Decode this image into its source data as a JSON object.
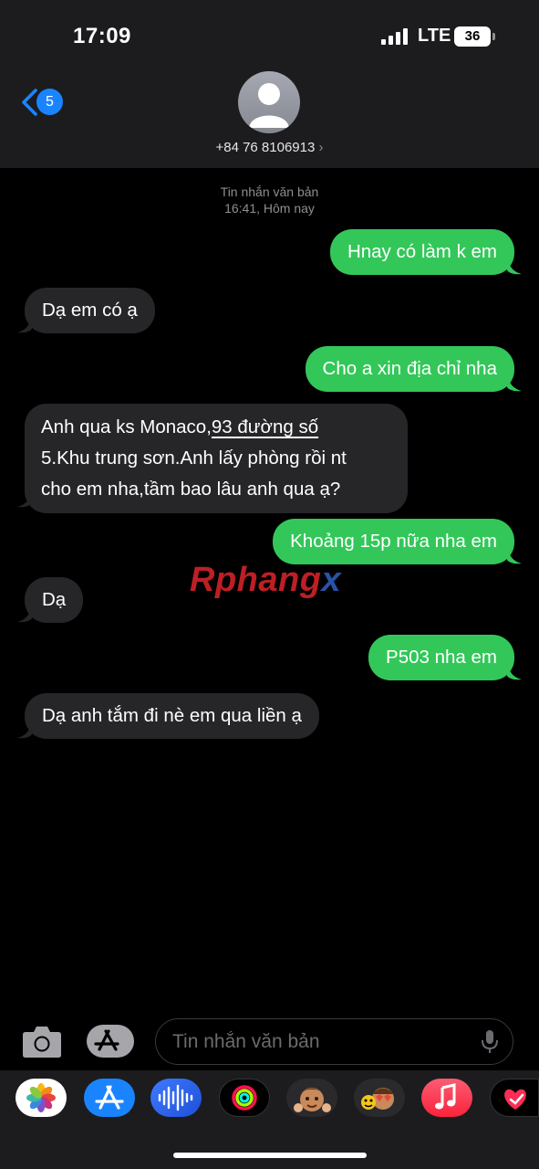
{
  "status_bar": {
    "time": "17:09",
    "network": "LTE",
    "battery": "36"
  },
  "header": {
    "back_badge": "5",
    "contact": "+84 76 8106913",
    "contact_chevron": "›"
  },
  "conversation": {
    "service_label": "Tin nhắn văn bản",
    "timestamp": "16:41, Hôm nay",
    "messages": [
      {
        "direction": "out",
        "text": "Hnay có làm k em"
      },
      {
        "direction": "in",
        "text": "Dạ em có ạ"
      },
      {
        "direction": "out",
        "text": "Cho a xin địa chỉ nha"
      },
      {
        "direction": "in",
        "parts": [
          "Anh qua ks Monaco,",
          "93 đường số",
          "5.Khu trung sơn.Anh lấy phòng rồi nt",
          "cho em nha,tầm bao lâu anh qua ạ?"
        ]
      },
      {
        "direction": "out",
        "text": "Khoảng 15p nữa nha em"
      },
      {
        "direction": "in",
        "text": "Dạ"
      },
      {
        "direction": "out",
        "text": "P503 nha em"
      },
      {
        "direction": "in",
        "text": "Dạ anh tắm đi nè em qua liền ạ"
      }
    ]
  },
  "watermark": {
    "part1": "R",
    "part2": "phang",
    "part3": "x"
  },
  "composer": {
    "placeholder": "Tin nhắn văn bản"
  },
  "app_drawer": [
    "photos-icon",
    "app-store-icon",
    "audio-message-icon",
    "activity-icon",
    "memoji-icon",
    "memoji-stickers-icon",
    "music-icon",
    "digital-touch-icon"
  ],
  "colors": {
    "outgoing": "#33c759",
    "incoming": "#262629",
    "header": "#1c1c1e",
    "accent": "#1a84ff"
  }
}
